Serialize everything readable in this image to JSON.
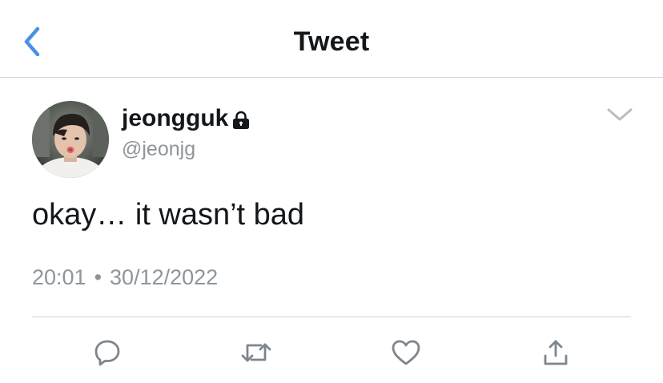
{
  "header": {
    "title": "Tweet",
    "back_icon": "chevron-left-icon"
  },
  "tweet": {
    "display_name": "jeongguk",
    "protected_icon": "lock-icon",
    "handle": "@jeonjg",
    "text": "okay… it wasn’t bad",
    "time": "20:01",
    "separator": "•",
    "date": "30/12/2022",
    "menu_icon": "chevron-down-icon"
  },
  "actions": [
    {
      "name": "reply",
      "icon": "reply-icon"
    },
    {
      "name": "retweet",
      "icon": "retweet-icon"
    },
    {
      "name": "like",
      "icon": "heart-icon"
    },
    {
      "name": "share",
      "icon": "share-icon"
    }
  ],
  "colors": {
    "accent": "#4a90e2",
    "text": "#14171a",
    "secondary": "#8d959c",
    "divider": "#d0d4d8",
    "icon": "#7d868e"
  }
}
